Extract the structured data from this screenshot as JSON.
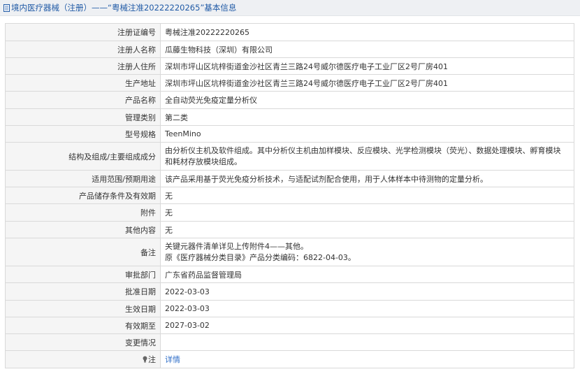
{
  "header": {
    "title": "境内医疗器械（注册）——“粤械注准20222220265”基本信息",
    "icon": "document-icon"
  },
  "rows": [
    {
      "label": "注册证编号",
      "value": "粤械注准20222220265"
    },
    {
      "label": "注册人名称",
      "value": "瓜藤生物科技（深圳）有限公司"
    },
    {
      "label": "注册人住所",
      "value": "深圳市坪山区坑梓街道金沙社区青兰三路24号威尔德医疗电子工业厂区2号厂房401"
    },
    {
      "label": "生产地址",
      "value": "深圳市坪山区坑梓街道金沙社区青兰三路24号威尔德医疗电子工业厂区2号厂房401"
    },
    {
      "label": "产品名称",
      "value": "全自动荧光免疫定量分析仪"
    },
    {
      "label": "管理类别",
      "value": "第二类"
    },
    {
      "label": "型号规格",
      "value": "TeenMino"
    },
    {
      "label": "结构及组成/主要组成成分",
      "value": "由分析仪主机及软件组成。其中分析仪主机由加样模块、反应模块、光学检测模块（荧光）、数据处理模块、孵育模块和耗材存放模块组成。"
    },
    {
      "label": "适用范围/预期用途",
      "value": "该产品采用基于荧光免疫分析技术，与适配试剂配合使用，用于人体样本中待测物的定量分析。"
    },
    {
      "label": "产品储存条件及有效期",
      "value": "无"
    },
    {
      "label": "附件",
      "value": "无"
    },
    {
      "label": "其他内容",
      "value": "无"
    },
    {
      "label": "备注",
      "value_lines": [
        "关键元器件清单详见上传附件4——其他。",
        "原《医疗器械分类目录》产品分类编码：6822-04-03。"
      ]
    },
    {
      "label": "审批部门",
      "value": "广东省药品监督管理局"
    },
    {
      "label": "批准日期",
      "value": "2022-03-03"
    },
    {
      "label": "生效日期",
      "value": "2022-03-03"
    },
    {
      "label": "有效期至",
      "value": "2027-03-02"
    },
    {
      "label": "变更情况",
      "value": ""
    },
    {
      "label": "注",
      "label_icon": "lightbulb-icon",
      "value": "详情",
      "is_link": true
    }
  ],
  "colors": {
    "title_text": "#205aa6",
    "title_bg": "#eef0f3",
    "label_bg": "#f5f5f5",
    "border": "#d9d9d9",
    "link": "#2f6ec8"
  }
}
